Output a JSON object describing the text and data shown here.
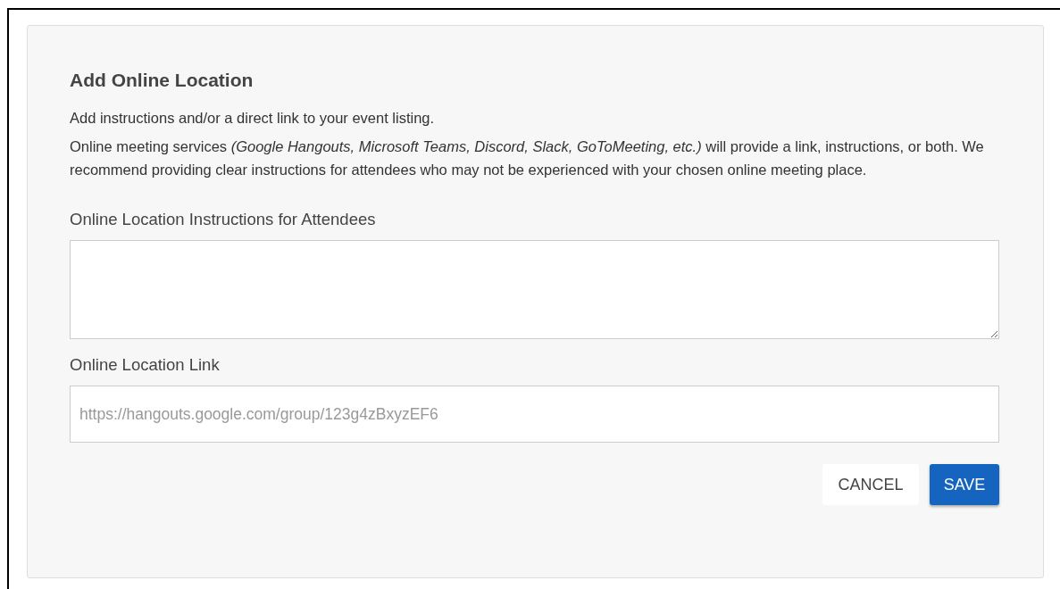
{
  "dialog": {
    "title": "Add Online Location",
    "paragraphs": [
      "Add instructions and/or a direct link to your event listing.",
      "Online meeting services *(Google Hangouts, Microsoft Teams, Discord, Slack, GoToMeeting, etc.)* will provide a link, instructions, or both. We recommend providing clear instructions for attendees who may not be experienced with your chosen online meeting place."
    ],
    "fields": [
      {
        "kind": "textarea",
        "label": "Online Location Instructions for Attendees"
      },
      {
        "kind": "text",
        "label": "Online Location Link",
        "placeholder": "https://hangouts.google.com/group/123g4zBxyzEF6"
      }
    ],
    "buttons": [
      {
        "kind": "flat",
        "label": "CANCEL"
      },
      {
        "kind": "primary",
        "label": "SAVE"
      }
    ]
  }
}
